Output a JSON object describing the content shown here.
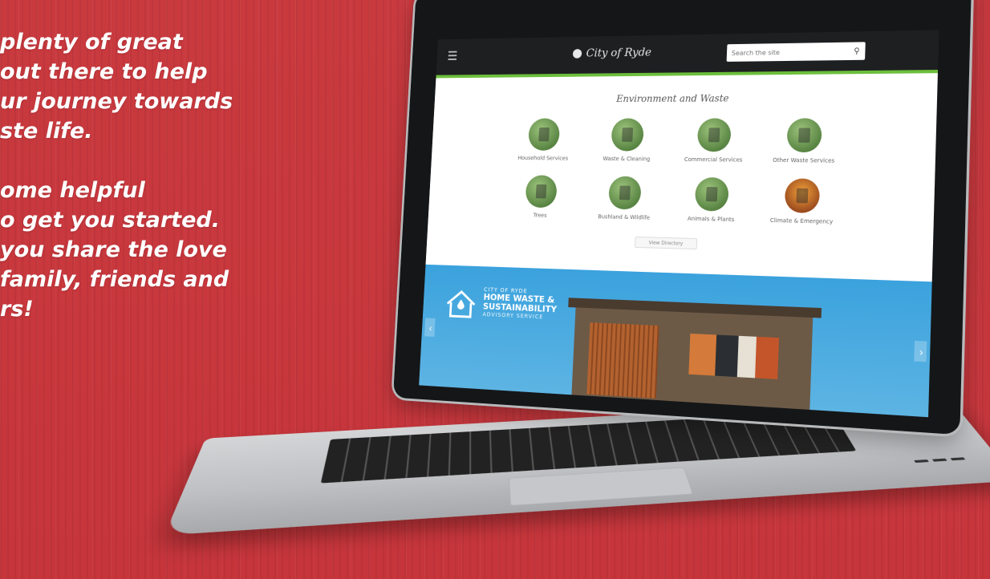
{
  "promo": {
    "lines": [
      "plenty of great",
      "out there to help",
      "ur journey towards",
      "ste life.",
      "",
      "ome helpful",
      "o get you started.",
      " you share the love",
      " family, friends and",
      "rs!"
    ]
  },
  "site": {
    "logo_text": "City of Ryde",
    "search_placeholder": "Search the site",
    "section_title": "Environment and Waste",
    "services": [
      {
        "label": "Household Services",
        "icon": "bin-icon"
      },
      {
        "label": "Waste & Cleaning",
        "icon": "sign-icon"
      },
      {
        "label": "Commercial Services",
        "icon": "collection-icon"
      },
      {
        "label": "Other Waste Services",
        "icon": "bags-icon"
      },
      {
        "label": "Trees",
        "icon": "tree-icon"
      },
      {
        "label": "Bushland & Wildlife",
        "icon": "wildlife-icon"
      },
      {
        "label": "Animals & Plants",
        "icon": "plant-icon"
      },
      {
        "label": "Climate & Emergency",
        "icon": "fire-icon"
      }
    ],
    "view_more_label": "View Directory",
    "banner": {
      "kicker": "CITY OF RYDE",
      "title_line1": "HOME WASTE &",
      "title_line2": "SUSTAINABILITY",
      "subtitle": "ADVISORY SERVICE",
      "prev_label": "‹",
      "next_label": "›"
    }
  },
  "colors": {
    "background": "#c8343a",
    "header": "#1e1f21",
    "accent_green": "#6cbf3c",
    "banner_blue": "#3ba2dd"
  }
}
